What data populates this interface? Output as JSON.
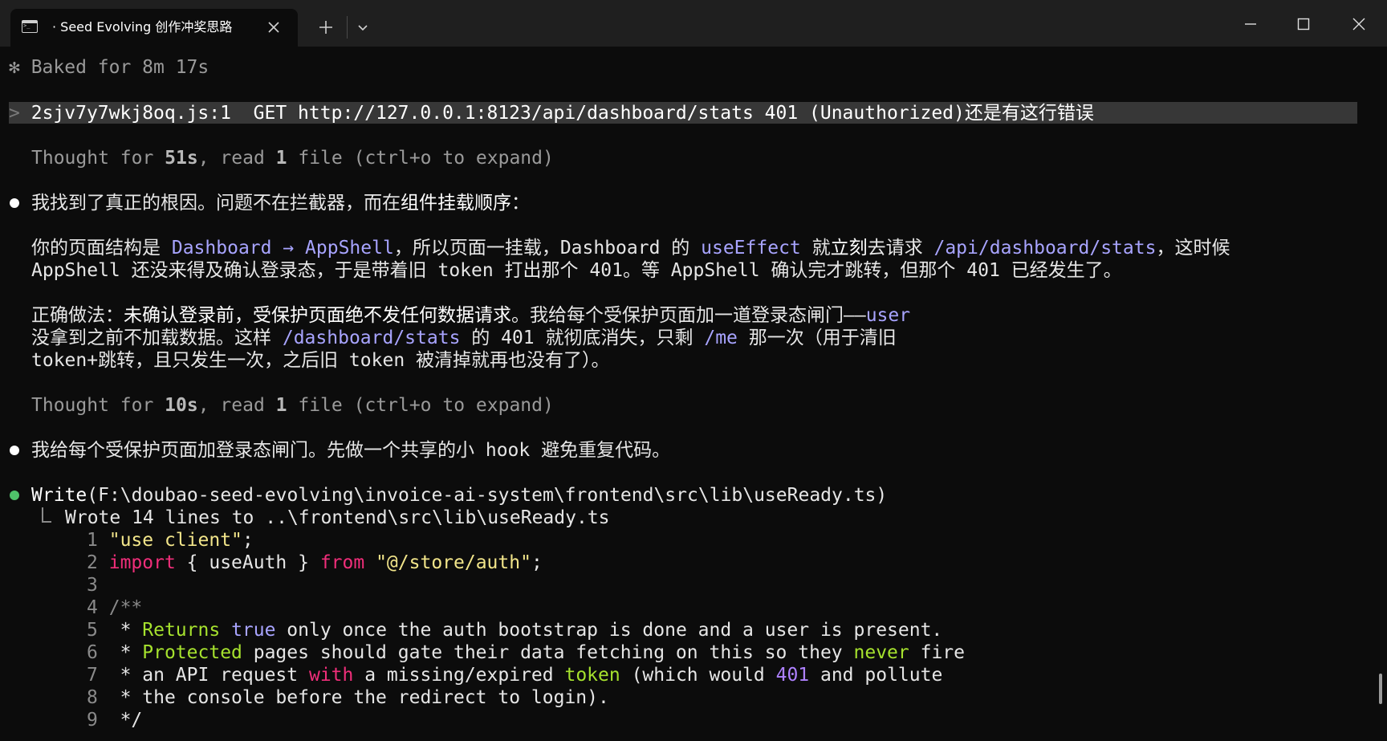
{
  "window": {
    "tab_title": "· Seed Evolving 创作冲奖思路",
    "tab_icon": "terminal-icon",
    "controls": [
      "minimize-icon",
      "maximize-icon",
      "close-icon"
    ]
  },
  "terminal": {
    "status": "✻ Baked for 8m 17s",
    "prompt_mark": ">",
    "prompt_text": "2sjv7y7wkj8oq.js:1  GET http://127.0.0.1:8123/api/dashboard/stats 401 (Unauthorized)还是有这行错误",
    "thought1": {
      "prefix": "Thought for ",
      "dur": "51s",
      "mid": ", read ",
      "count": "1",
      "suffix": " file (ctrl+o to expand)"
    },
    "msg1": {
      "pre": "我找到了真正的根因。问题不在拦截器，而在",
      "bold": "组件挂载顺序",
      "post": "："
    },
    "para1_line1": {
      "t1": "你的页面结构是 ",
      "l1": "Dashboard → AppShell",
      "t2": "，所以页面一挂载，Dashboard 的 ",
      "l2": "useEffect",
      "t3": " 就",
      "b1": "立刻",
      "t4": "去请求 ",
      "l3": "/api/dashboard/stats",
      "t5": "，这时候"
    },
    "para1_line2": "AppShell 还没来得及确认登录态，于是带着旧 token 打出那个 401。等 AppShell 确认完才跳转，但那个 401 已经发生了。",
    "para2_line1": {
      "t1": "正确做法：",
      "b1": "未确认登录前，受保护页面绝不发任何数据请求",
      "t2": "。我给每个受保护页面加一道登录态闸门——",
      "l1": "user"
    },
    "para2_line2": {
      "t1": "没拿到之前不加载数据。这样 ",
      "l1": "/dashboard/stats",
      "t2": " 的 401 就彻底消失，只剩 ",
      "l2": "/me",
      "t3": " 那一次（用于清旧"
    },
    "para2_line3": "token+跳转，且只发生一次，之后旧 token 被清掉就再也没有了）。",
    "thought2": {
      "prefix": "Thought for ",
      "dur": "10s",
      "mid": ", read ",
      "count": "1",
      "suffix": " file (ctrl+o to expand)"
    },
    "msg2": "我给每个受保护页面加登录态闸门。先做一个共享的小 hook 避免重复代码。",
    "write_call": {
      "fn": "Write",
      "arg": "(F:\\doubao-seed-evolving\\invoice-ai-system\\frontend\\src\\lib\\useReady.ts)"
    },
    "write_result": "Wrote 14 lines to ..\\frontend\\src\\lib\\useReady.ts",
    "code": {
      "n1": "1",
      "n2": "2",
      "n3": "3",
      "n4": "4",
      "n5": "5",
      "n6": "6",
      "n7": "7",
      "n8": "8",
      "n9": "9",
      "l1": "\"use client\"",
      "l1_end": ";",
      "l2_import": "import",
      "l2_braces": " { useAuth } ",
      "l2_from": "from",
      "l2_sp": " ",
      "l2_str": "\"@/store/auth\"",
      "l2_end": ";",
      "l4": "/**",
      "l5_a": " * ",
      "l5_b": "Returns",
      "l5_c": " ",
      "l5_d": "true",
      "l5_e": " only once the auth bootstrap is done and a user is present.",
      "l6_a": " * ",
      "l6_b": "Protected",
      "l6_c": " pages should gate their data fetching on this so they ",
      "l6_d": "never",
      "l6_e": " fire",
      "l7_a": " * an API request ",
      "l7_b": "with",
      "l7_c": " a missing/expired ",
      "l7_d": "token",
      "l7_e": " (which would ",
      "l7_f": "401",
      "l7_g": " and pollute",
      "l8": " * the console before the redirect to login).",
      "l9": " */"
    }
  }
}
